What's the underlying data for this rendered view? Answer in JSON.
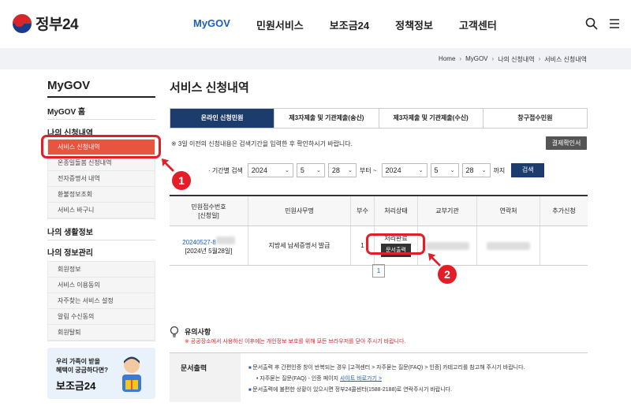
{
  "header": {
    "logo_text": "정부24",
    "nav": [
      "MyGOV",
      "민원서비스",
      "보조금24",
      "정책정보",
      "고객센터"
    ],
    "active_nav": "MyGOV"
  },
  "breadcrumb": [
    "Home",
    "MyGOV",
    "나의 신청내역",
    "서비스 신청내역"
  ],
  "sidebar": {
    "title": "MyGOV",
    "home": "MyGOV 홈",
    "group1": "나의 신청내역",
    "group1_items": [
      "서비스 신청내역",
      "온종일돌봄 신청내역",
      "전자증명서 내역",
      "환불정보조회",
      "서비스 바구니"
    ],
    "group2": "나의 생활정보",
    "group3": "나의 정보관리",
    "group3_items": [
      "회원정보",
      "서비스 이용동의",
      "자주찾는 서비스 설정",
      "알림 수신동의",
      "회원탈퇴"
    ],
    "banner": {
      "line1": "우리 가족이 받을",
      "line2": "혜택이 궁금하다면?",
      "brand": "보조금24"
    }
  },
  "main": {
    "title": "서비스 신청내역",
    "tabs": [
      "온라인 신청민원",
      "제3자제출 및 기관제출(송신)",
      "제3자제출 및 기관제출(수신)",
      "창구접수민원"
    ],
    "active_tab": 0,
    "notice": "※ 3일 이전의 신청내용은 검색기간을 입력한 후 확인하시기 바랍니다.",
    "print_all_button": "결제확인서",
    "filter": {
      "label": "· 기간별 검색",
      "from_year": "2024",
      "from_month": "5",
      "from_day": "28",
      "mid_label": "부터 ~",
      "to_year": "2024",
      "to_month": "5",
      "to_day": "28",
      "end_label": "까지",
      "search_button": "검색"
    },
    "table": {
      "headers": [
        "민원접수번호\n[신청일]",
        "민원사무명",
        "부수",
        "처리상태",
        "교부기관",
        "연락처",
        "추가신청"
      ],
      "rows": [
        {
          "receipt_no": "20240527-8",
          "date": "[2024년 5월28일]",
          "service": "지방세 납세증명서 발급",
          "copies": "1",
          "status": "처리완료",
          "action_button": "문서출력"
        }
      ]
    },
    "pagination": {
      "current": "1"
    }
  },
  "notes": {
    "title": "유의사항",
    "warning": "※ 공공장소에서 사용하신 이후에는 개인정보 보호를 위해 모든 브라우저를 닫아 주시기 바랍니다.",
    "doc_label": "문서출력",
    "line1": "문서출력 후 간편인증 창이 반복되는 경우 [고객센터 > 자주묻는 질문(FAQ) > 인증] 카테고리를 참고해 주시기 바랍니다.",
    "line2_prefix": "• 자주묻는 질문(FAQ) - 인증 페이지",
    "line2_link": "사이트 바로가기 >",
    "line3": "문서출력에 불편한 상황이 있으시면 정부24콜센터(1588-2188)로 연락주시기 바랍니다."
  },
  "annotations": {
    "badge1": "1",
    "badge2": "2"
  },
  "colors": {
    "primary": "#1d3c6e",
    "accent_blue": "#1b5fb6",
    "highlight_red": "#e41e26",
    "active_menu": "#e6553d"
  }
}
